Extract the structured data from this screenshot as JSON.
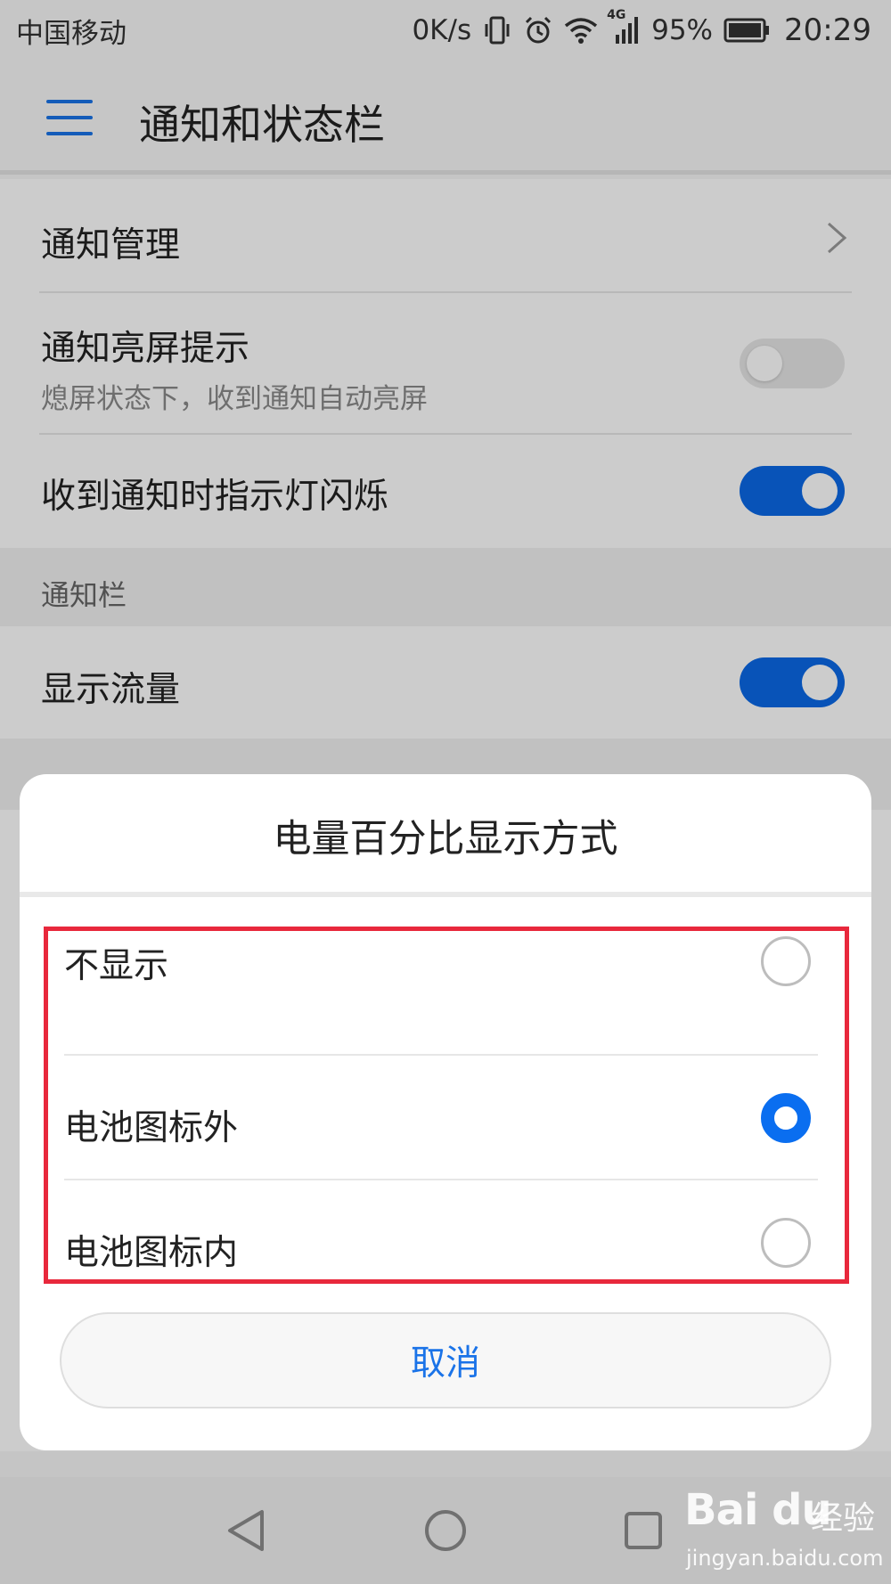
{
  "status_bar": {
    "carrier": "中国移动",
    "net_speed": "0K/s",
    "network_badge": "4G",
    "battery_percent": "95%",
    "time": "20:29",
    "icons": [
      "vibrate-icon",
      "alarm-icon",
      "wifi-icon",
      "cellular-signal-icon",
      "battery-icon"
    ]
  },
  "app_bar": {
    "title": "通知和状态栏",
    "menu_icon": "hamburger-menu-icon",
    "accent_color": "#1a73e8"
  },
  "settings": {
    "notification_management": {
      "label": "通知管理"
    },
    "wake_screen": {
      "label": "通知亮屏提示",
      "subtitle": "熄屏状态下，收到通知自动亮屏",
      "enabled": false
    },
    "led_blink": {
      "label": "收到通知时指示灯闪烁",
      "enabled": true
    },
    "section_notification_bar": "通知栏",
    "show_traffic": {
      "label": "显示流量",
      "enabled": true
    },
    "toggle_on_color": "#0a68e6"
  },
  "dialog": {
    "title": "电量百分比显示方式",
    "options": [
      {
        "label": "不显示",
        "selected": false
      },
      {
        "label": "电池图标外",
        "selected": true
      },
      {
        "label": "电池图标内",
        "selected": false
      }
    ],
    "cancel_label": "取消",
    "highlight_color": "#e8283c"
  },
  "nav_bar": {
    "icons": [
      "back-icon",
      "home-icon",
      "recent-apps-icon"
    ]
  },
  "watermark": {
    "brand": "Bai du",
    "cn": "经验",
    "url": "jingyan.baidu.com"
  }
}
